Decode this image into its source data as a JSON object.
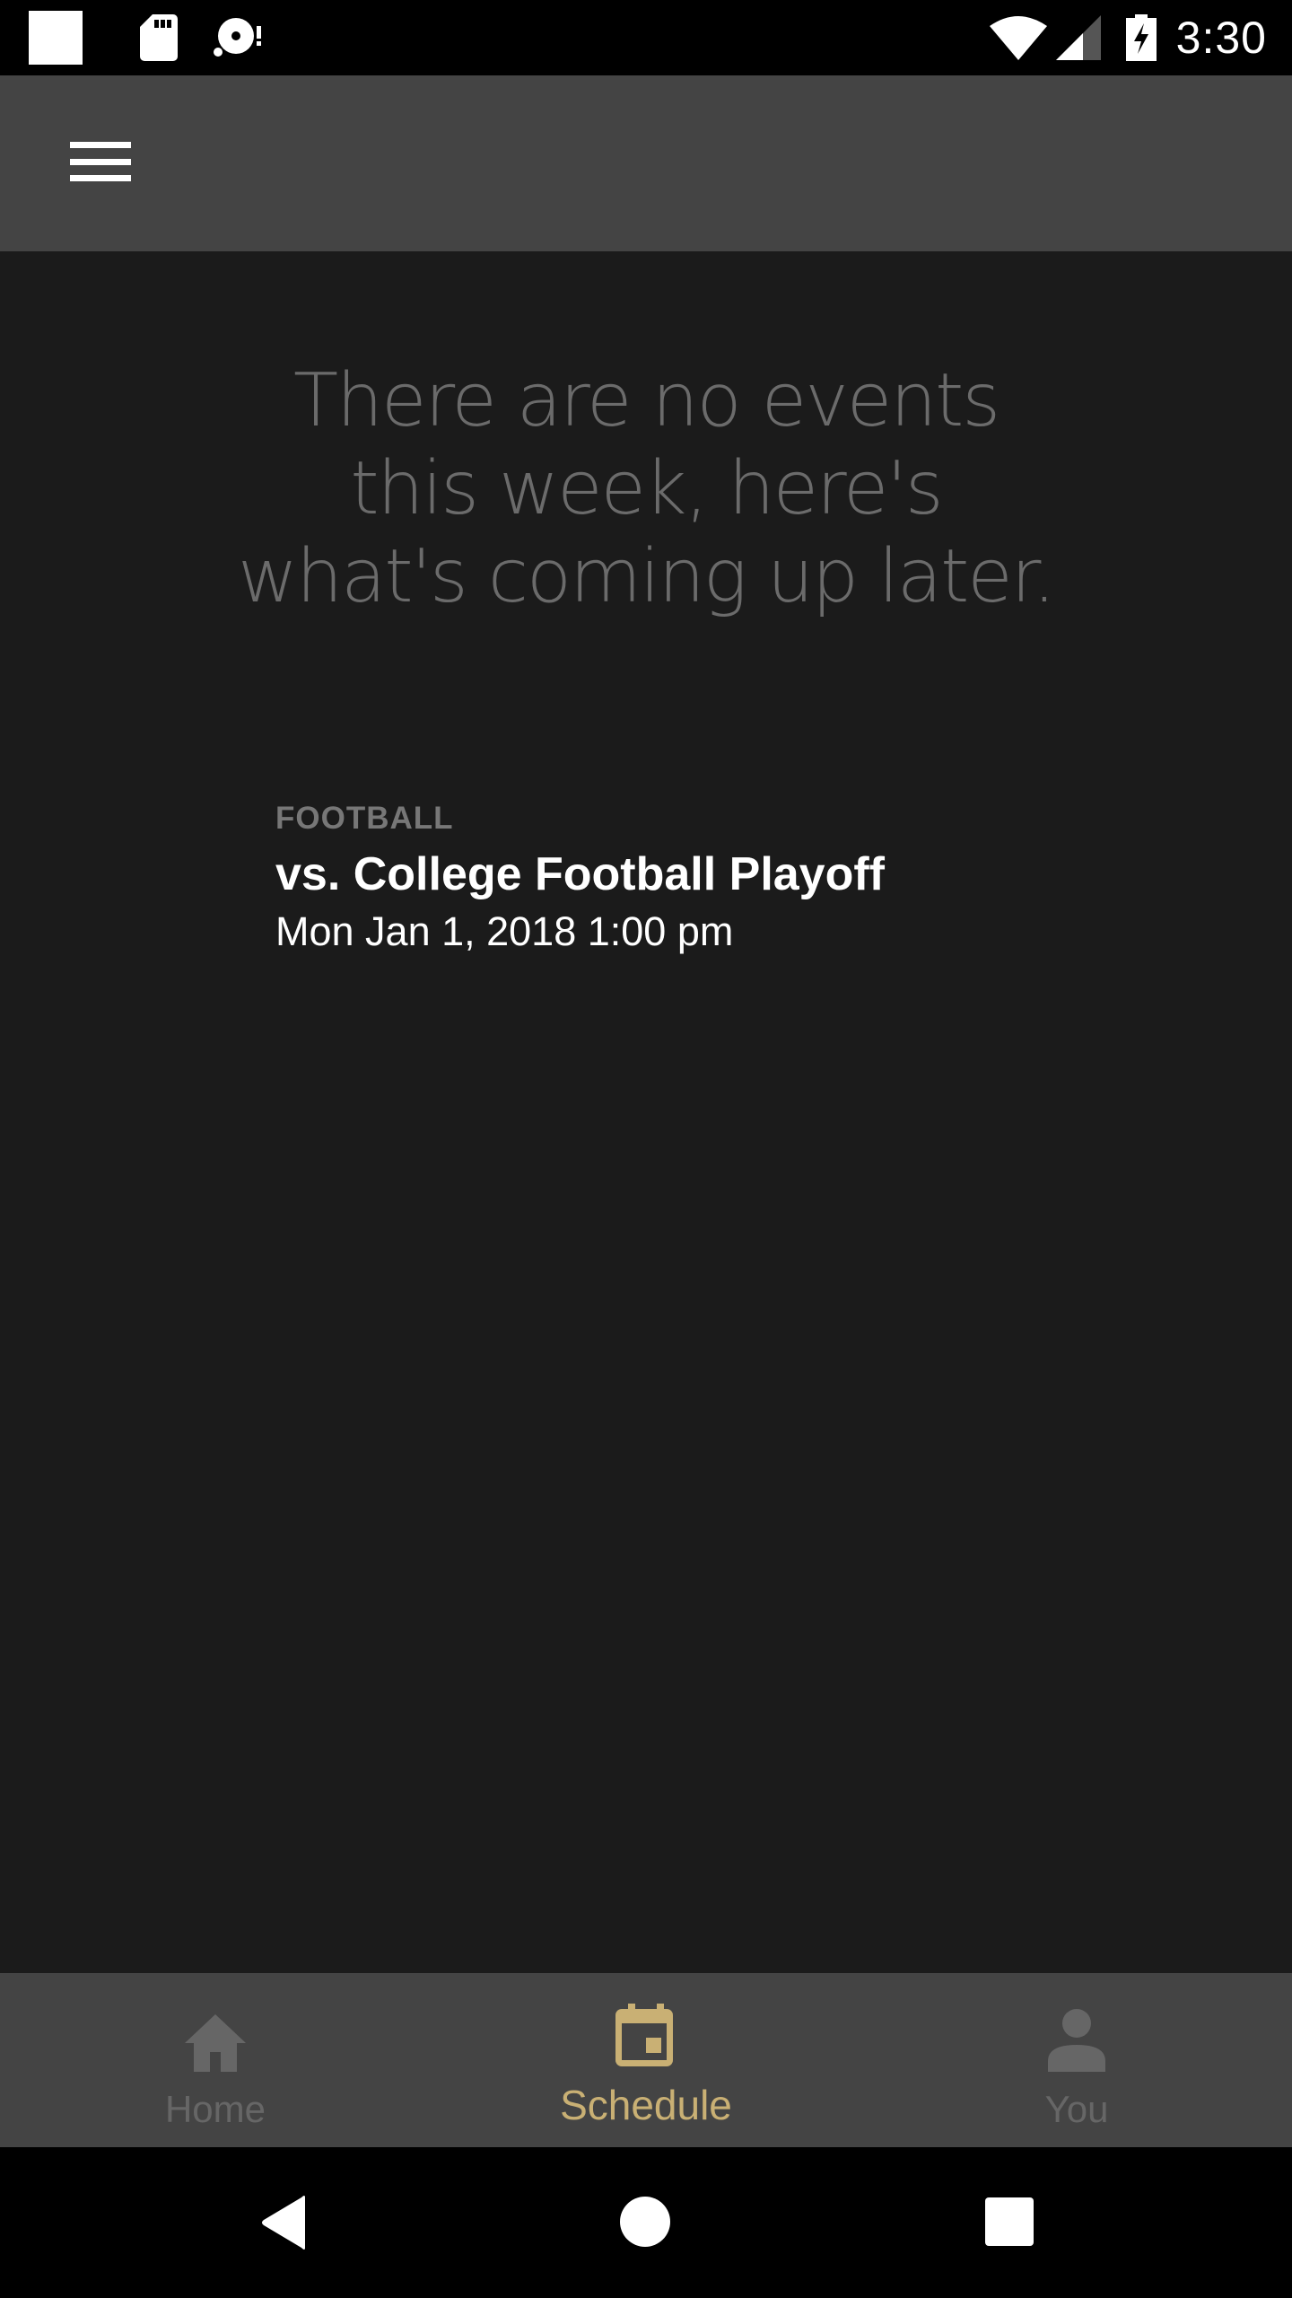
{
  "status_bar": {
    "left_icons": [
      "notification-square-icon",
      "sd-card-icon",
      "disc-alert-icon"
    ],
    "right_icons": [
      "wifi-icon",
      "cell-signal-icon",
      "battery-charging-icon"
    ],
    "time": "3:30"
  },
  "app_bar": {
    "menu_icon": "hamburger-menu-icon"
  },
  "main": {
    "empty_message": "There are no events this week, here's what's coming up later.",
    "events": [
      {
        "sport": "FOOTBALL",
        "title": "vs. College Football Playoff",
        "datetime": "Mon Jan 1, 2018 1:00 pm"
      }
    ]
  },
  "bottom_nav": {
    "items": [
      {
        "label": "Home",
        "icon": "home-icon",
        "active": false
      },
      {
        "label": "Schedule",
        "icon": "calendar-icon",
        "active": true
      },
      {
        "label": "You",
        "icon": "person-icon",
        "active": false
      }
    ],
    "active_color": "#c9b074",
    "inactive_color": "#666666"
  },
  "system_nav": {
    "buttons": [
      "back-icon",
      "home-circle-icon",
      "recents-icon"
    ]
  }
}
